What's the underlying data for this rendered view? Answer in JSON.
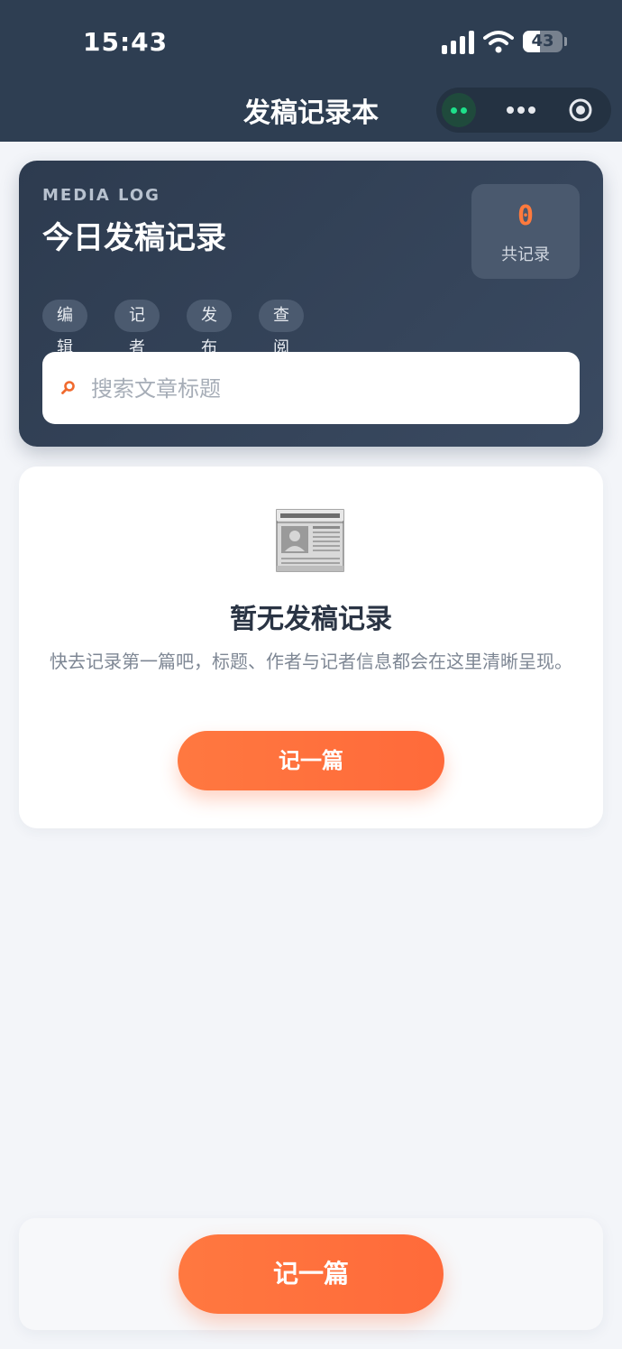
{
  "status_bar": {
    "time": "15:43",
    "battery": "43",
    "battery_level_percent": 43
  },
  "nav": {
    "title": "发稿记录本"
  },
  "hero": {
    "kicker": "MEDIA LOG",
    "title": "今日发稿记录",
    "count_value": "0",
    "count_label": "共记录",
    "tags": [
      "编辑",
      "记者",
      "发布",
      "查阅"
    ],
    "search_placeholder": "搜索文章标题"
  },
  "empty_state": {
    "icon": "newspaper-icon",
    "title": "暂无发稿记录",
    "description": "快去记录第一篇吧，标题、作者与记者信息都会在这里清晰呈现。",
    "button_label": "记一篇"
  },
  "bottom_bar": {
    "button_label": "记一篇"
  },
  "colors": {
    "header_bg": "#2e3e52",
    "accent": "#ff7340",
    "page_bg": "#f3f5f9"
  }
}
